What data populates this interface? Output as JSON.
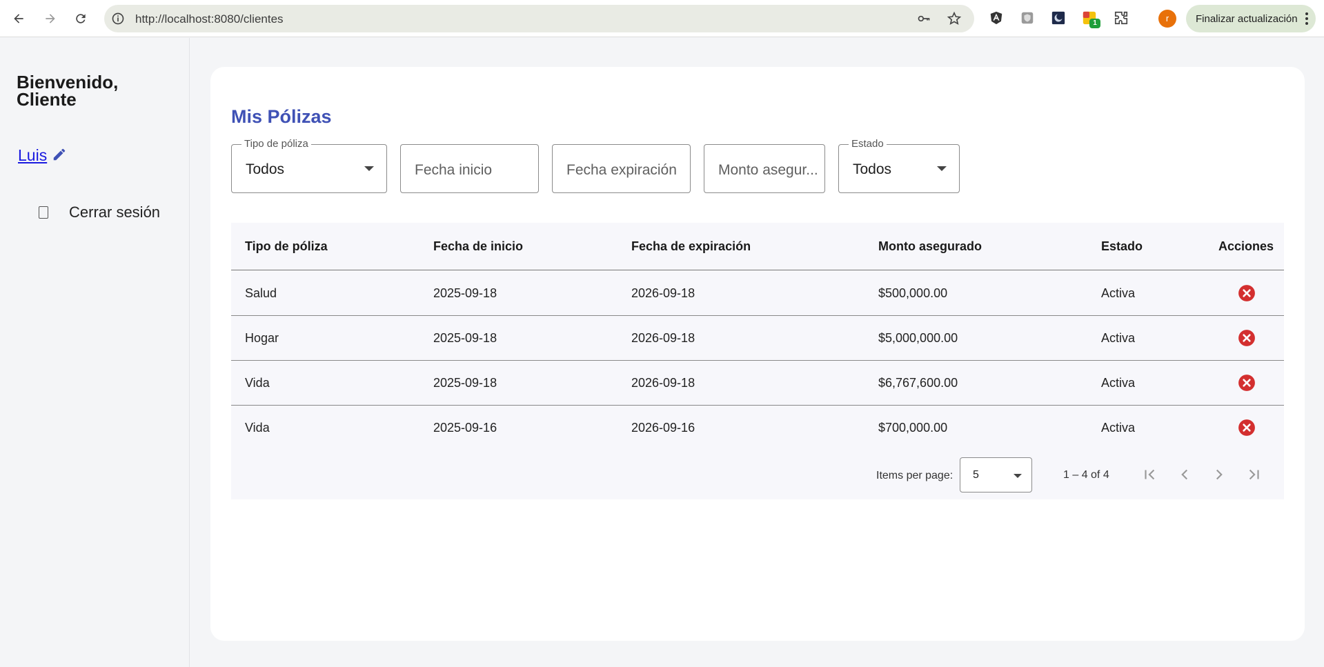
{
  "browser": {
    "url": "http://localhost:8080/clientes",
    "update_label": "Finalizar actualización",
    "profile_initial": "r",
    "extension_badge": "1"
  },
  "sidebar": {
    "welcome": "Bienvenido, Cliente",
    "user_name": "Luis",
    "logout_label": "Cerrar sesión"
  },
  "main": {
    "title": "Mis Pólizas",
    "filters": {
      "tipo": {
        "label": "Tipo de póliza",
        "value": "Todos"
      },
      "fecha_inicio": {
        "placeholder": "Fecha inicio"
      },
      "fecha_expiracion": {
        "placeholder": "Fecha expiración"
      },
      "monto": {
        "placeholder": "Monto asegur..."
      },
      "estado": {
        "label": "Estado",
        "value": "Todos"
      }
    },
    "table": {
      "columns": [
        "Tipo de póliza",
        "Fecha de inicio",
        "Fecha de expiración",
        "Monto asegurado",
        "Estado",
        "Acciones"
      ],
      "rows": [
        [
          "Salud",
          "2025-09-18",
          "2026-09-18",
          "$500,000.00",
          "Activa"
        ],
        [
          "Hogar",
          "2025-09-18",
          "2026-09-18",
          "$5,000,000.00",
          "Activa"
        ],
        [
          "Vida",
          "2025-09-18",
          "2026-09-18",
          "$6,767,600.00",
          "Activa"
        ],
        [
          "Vida",
          "2025-09-16",
          "2026-09-16",
          "$700,000.00",
          "Activa"
        ]
      ]
    },
    "paginator": {
      "items_per_page_label": "Items per page:",
      "items_per_page": "5",
      "range": "1 – 4 of 4"
    }
  },
  "colors": {
    "title": "#3f51b5",
    "link": "#1a1ae0",
    "cancel": "#d32f2f",
    "update_button": "#dde8d5"
  }
}
